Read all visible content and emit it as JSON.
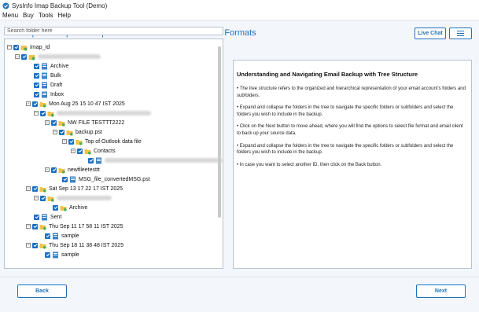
{
  "window": {
    "title": "SysInfo Imap Backup Tool (Demo)"
  },
  "menu": [
    "Menu",
    "Buy",
    "Tools",
    "Help"
  ],
  "header": {
    "title": "Backup and Export Multiple IMAP Emails to Various File Formats",
    "live_chat": "Live Chat"
  },
  "search": {
    "placeholder": "Search folder here",
    "value": ""
  },
  "tree": {
    "root": "Imap_Id",
    "items": [
      "Archive",
      "Bulk",
      "Draft",
      "Inbox",
      "Mon Aug 25 15 10 47 IST 2025",
      "NW FILE TESTTT2222",
      "backup.pst",
      "Top of Outlook data file",
      "Contacts",
      "newfileetesttt",
      "MSG_file_convertedMSG.pst",
      "Sat Sep 13 17 22 17 IST 2025",
      "Archive",
      "Sent",
      "Thu Sep 11 17 58 11 IST 2025",
      "sample",
      "Thu Sep 18 11 38 48 IST 2025",
      "sample"
    ]
  },
  "info": {
    "title": "Understanding and Navigating Email Backup with Tree Structure",
    "bullets": [
      "• The tree structure refers to the organized and hierarchical representation of your email account's folders and subfolders.",
      "• Expand and collapse the folders in the tree to navigate the specific folders or subfolders and select the folders you wish to include in the backup.",
      "• Click on the Next button to move ahead, where you will find the options to select file format and email client to back up your source data.",
      "• Expand and collapse the folders in the tree to navigate the specific folders or subfolders and select the folders you wish to include in the backup.",
      "• In case you want to select another ID, then click on the Back button."
    ]
  },
  "footer": {
    "back": "Back",
    "next": "Next"
  },
  "colors": {
    "accent": "#1e73be",
    "checkbox": "#1d6fc0",
    "folder": "#f2c14e"
  }
}
